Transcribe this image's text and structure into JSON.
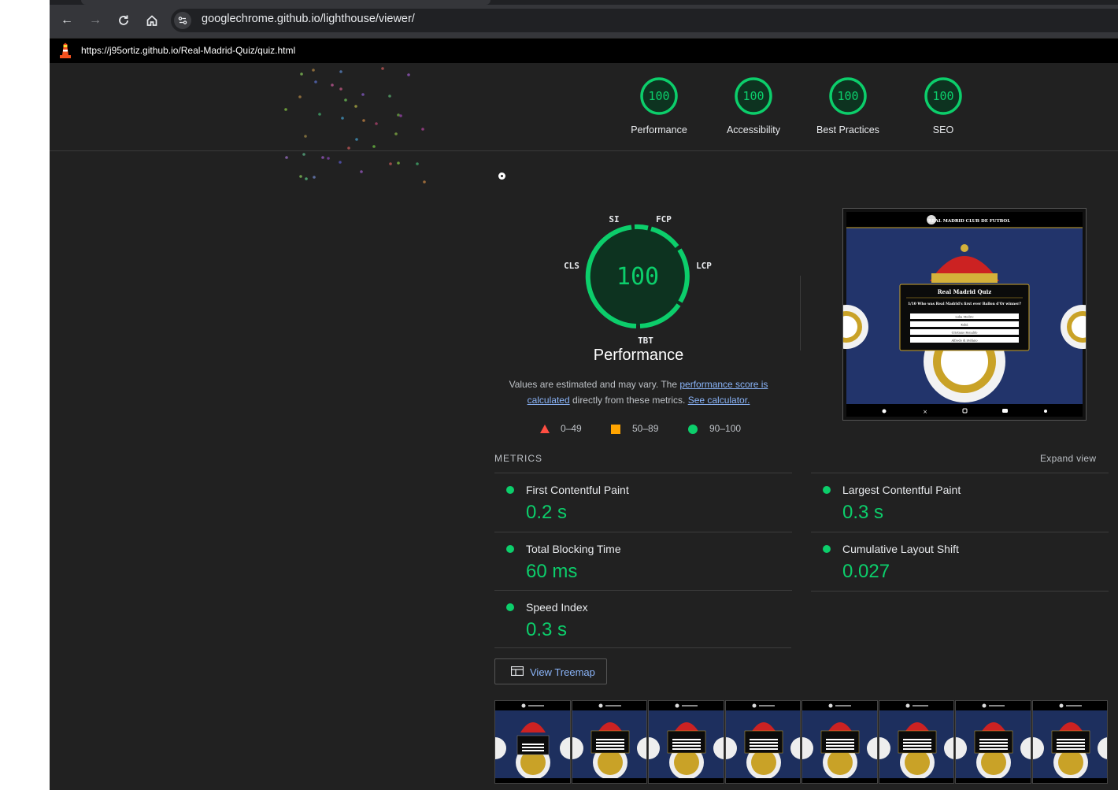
{
  "browser": {
    "url": "googlechrome.github.io/lighthouse/viewer/"
  },
  "report": {
    "url": "https://j95ortiz.github.io/Real-Madrid-Quiz/quiz.html"
  },
  "scores": [
    {
      "label": "Performance",
      "value": "100"
    },
    {
      "label": "Accessibility",
      "value": "100"
    },
    {
      "label": "Best Practices",
      "value": "100"
    },
    {
      "label": "SEO",
      "value": "100"
    }
  ],
  "performance": {
    "score": "100",
    "title": "Performance",
    "gauge_labels": {
      "si": "SI",
      "fcp": "FCP",
      "lcp": "LCP",
      "tbt": "TBT",
      "cls": "CLS"
    },
    "desc_prefix": "Values are estimated and may vary. The ",
    "desc_link1": "performance score is calculated",
    "desc_middle": " directly from these metrics. ",
    "desc_link2": "See calculator."
  },
  "legend": [
    {
      "range": "0–49",
      "color": "#ff4e42"
    },
    {
      "range": "50–89",
      "color": "#ffa400"
    },
    {
      "range": "90–100",
      "color": "#0cce6b"
    }
  ],
  "metrics_section": {
    "heading": "METRICS",
    "expand_label": "Expand view",
    "items": [
      {
        "name": "First Contentful Paint",
        "value": "0.2 s"
      },
      {
        "name": "Largest Contentful Paint",
        "value": "0.3 s"
      },
      {
        "name": "Total Blocking Time",
        "value": "60 ms"
      },
      {
        "name": "Cumulative Layout Shift",
        "value": "0.027"
      },
      {
        "name": "Speed Index",
        "value": "0.3 s"
      }
    ]
  },
  "treemap_button": "View Treemap",
  "screenshot": {
    "header": "REAL MADRID CLUB DE FUTBOL",
    "quiz_title": "Real Madrid Quiz",
    "question": "1/10 Who was Real Madrid's first ever Ballon d'Or winner?",
    "answers": [
      "Luka Modric",
      "Kaká",
      "Cristiano Ronaldo",
      "Alfredo di Stéfano"
    ]
  },
  "colors": {
    "pass": "#0cce6b",
    "link": "#8ab4f8",
    "bg": "#212121"
  }
}
